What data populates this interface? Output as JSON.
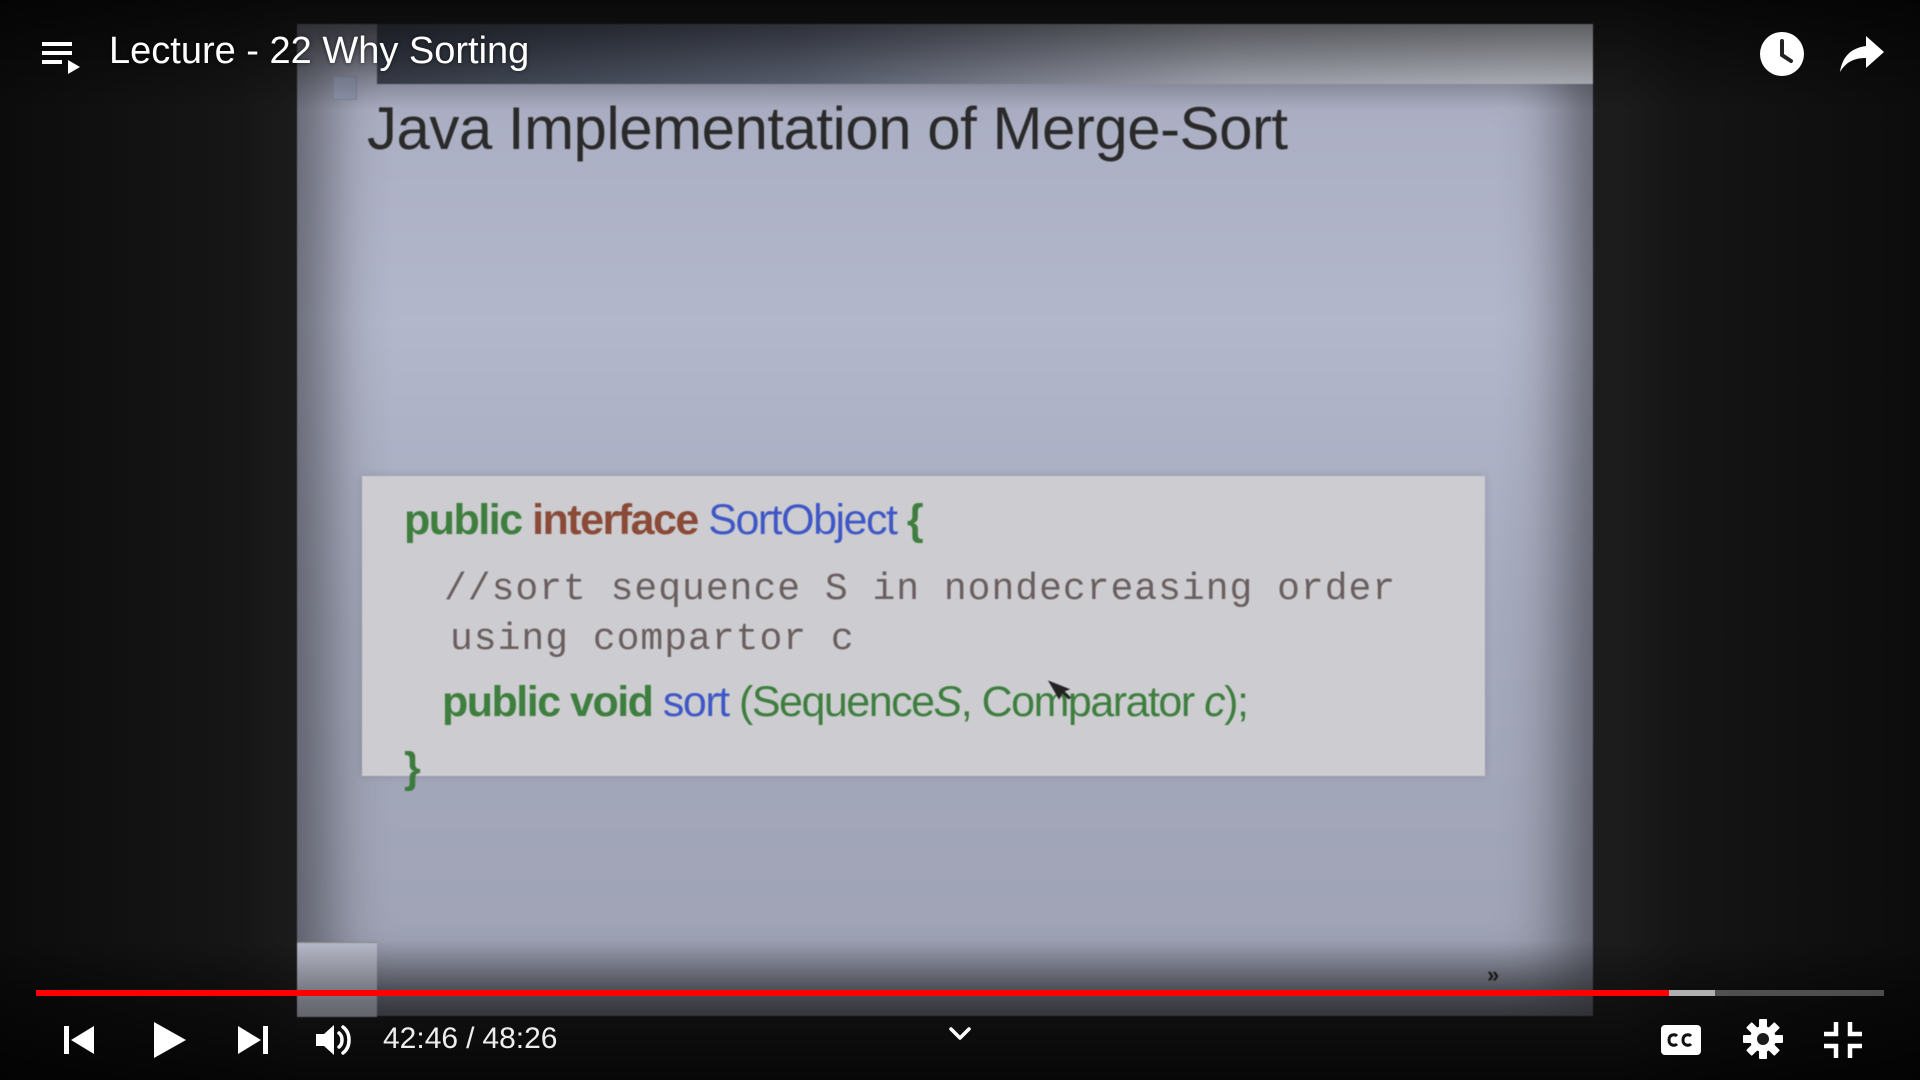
{
  "player": {
    "title": "Lecture - 22 Why Sorting",
    "time": {
      "current": "42:46",
      "separator": "/",
      "duration": "48:26"
    },
    "progress": {
      "played_fraction": 0.8835,
      "buffered_fraction": 0.9088
    },
    "accent_color": "#ff0000"
  },
  "icons": {
    "playlist": "playlist-icon",
    "watch_later": "clock-icon",
    "share": "share-arrow-icon",
    "previous": "skip-previous-icon",
    "play": "play-icon",
    "next": "skip-next-icon",
    "volume": "volume-icon",
    "chapter": "chevron-down-icon",
    "captions": "cc-icon",
    "settings": "gear-icon",
    "fullscreen": "exit-fullscreen-icon"
  },
  "slide": {
    "title": "Java Implementation of Merge-Sort",
    "code": {
      "kw_public": "public",
      "kw_interface": "interface",
      "class_name": "SortObject",
      "open_brace": "{",
      "comment_line_1": "//sort sequence S in nondecreasing order",
      "comment_line_2": "using compartor c",
      "kw_public_void": "public void",
      "method_name": "sort",
      "params_open": "(Sequence",
      "param_s": "S",
      "params_mid": ", Comparator",
      "param_c": "c",
      "params_close": ");",
      "close_brace": "}"
    },
    "nav_glyph": "»"
  }
}
